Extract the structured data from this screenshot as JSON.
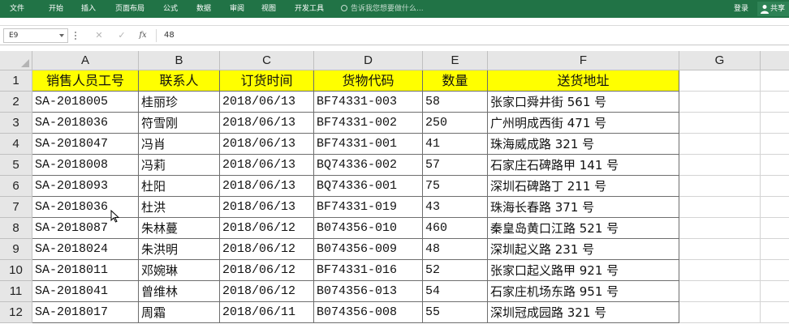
{
  "ribbon": {
    "tabs": [
      "文件",
      "开始",
      "插入",
      "页面布局",
      "公式",
      "数据",
      "审阅",
      "视图",
      "开发工具"
    ],
    "tell_me": "告诉我您想要做什么...",
    "login": "登录",
    "share": "共享"
  },
  "formula_bar": {
    "name_box": "E9",
    "cancel": "✕",
    "enter": "✓",
    "fx": "fx",
    "value": "48"
  },
  "sheet": {
    "columns": [
      "A",
      "B",
      "C",
      "D",
      "E",
      "F",
      "G"
    ],
    "header_row": {
      "num": "1",
      "cells": [
        "销售人员工号",
        "联系人",
        "订货时间",
        "货物代码",
        "数量",
        "送货地址"
      ]
    },
    "rows": [
      {
        "num": "2",
        "cells": [
          "SA-2018005",
          "桂丽珍",
          "2018/06/13",
          "BF74331-003",
          "58",
          "张家口舜井街 561 号"
        ]
      },
      {
        "num": "3",
        "cells": [
          "SA-2018036",
          "符雪刚",
          "2018/06/13",
          "BF74331-002",
          "250",
          "广州明成西街 471 号"
        ]
      },
      {
        "num": "4",
        "cells": [
          "SA-2018047",
          "冯肖",
          "2018/06/13",
          "BF74331-001",
          "41",
          "珠海威成路 321 号"
        ]
      },
      {
        "num": "5",
        "cells": [
          "SA-2018008",
          "冯莉",
          "2018/06/13",
          "BQ74336-002",
          "57",
          "石家庄石碑路甲 141 号"
        ]
      },
      {
        "num": "6",
        "cells": [
          "SA-2018093",
          "杜阳",
          "2018/06/13",
          "BQ74336-001",
          "75",
          "深圳石碑路丁 211 号"
        ]
      },
      {
        "num": "7",
        "cells": [
          "SA-2018036",
          "杜洪",
          "2018/06/13",
          "BF74331-019",
          "43",
          "珠海长春路 371 号"
        ]
      },
      {
        "num": "8",
        "cells": [
          "SA-2018087",
          "朱林蔓",
          "2018/06/12",
          "B074356-010",
          "460",
          "秦皇岛黄口江路 521 号"
        ]
      },
      {
        "num": "9",
        "cells": [
          "SA-2018024",
          "朱洪明",
          "2018/06/12",
          "B074356-009",
          "48",
          "深圳起义路 231 号"
        ]
      },
      {
        "num": "10",
        "cells": [
          "SA-2018011",
          "邓婉琳",
          "2018/06/12",
          "BF74331-016",
          "52",
          "张家口起义路甲 921 号"
        ]
      },
      {
        "num": "11",
        "cells": [
          "SA-2018041",
          "曾维林",
          "2018/06/12",
          "B074356-013",
          "54",
          "石家庄机场东路 951 号"
        ]
      },
      {
        "num": "12",
        "cells": [
          "SA-2018017",
          "周霜",
          "2018/06/11",
          "B074356-008",
          "55",
          "深圳冠成园路 321 号"
        ]
      }
    ]
  },
  "colors": {
    "ribbon": "#217346",
    "header_fill": "#ffff00",
    "grid_header": "#e6e6e6"
  }
}
